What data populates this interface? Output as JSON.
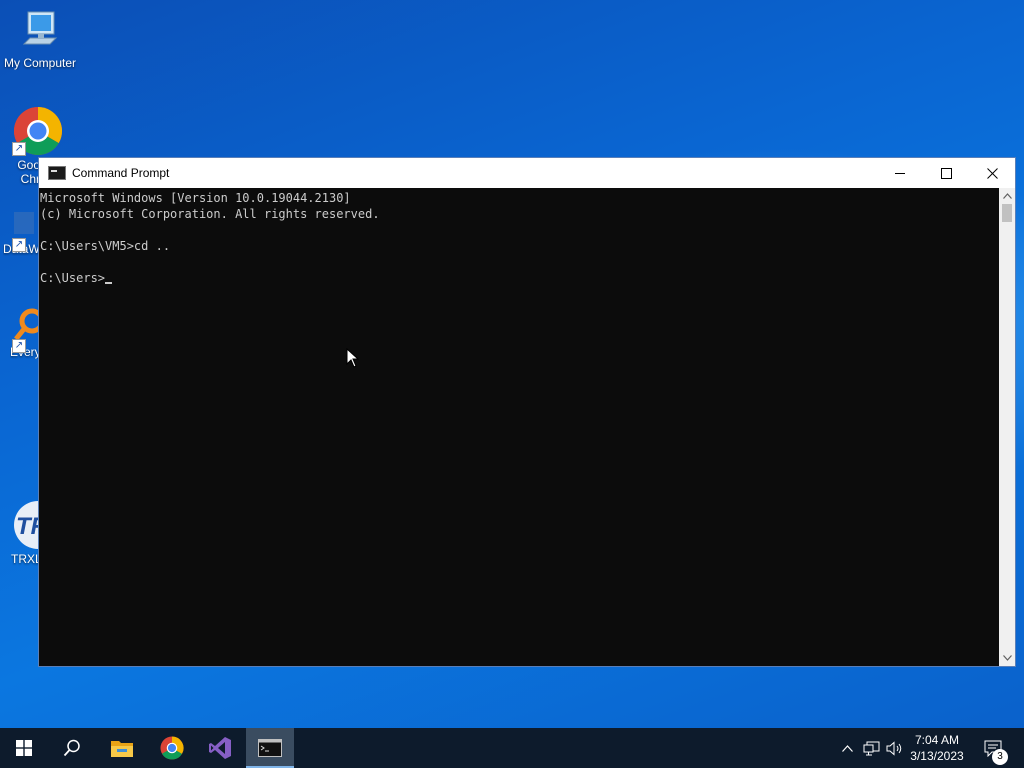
{
  "desktop": {
    "icons": [
      {
        "label": "My Computer",
        "icon": "computer-icon"
      },
      {
        "label": "Goo\nChr",
        "icon": "chrome-icon"
      },
      {
        "label": "DataW",
        "icon": "datawrapper-icon"
      },
      {
        "label": "Every",
        "icon": "everything-search-icon"
      },
      {
        "label": "TRXL",
        "icon": "trxl-icon"
      }
    ]
  },
  "window": {
    "title": "Command Prompt",
    "lines": [
      "Microsoft Windows [Version 10.0.19044.2130]",
      "(c) Microsoft Corporation. All rights reserved.",
      "",
      "C:\\Users\\VM5>cd ..",
      ""
    ],
    "prompt": "C:\\Users>"
  },
  "taskbar": {
    "items": [
      "start-icon",
      "search-icon",
      "file-explorer-icon",
      "chrome-icon",
      "visual-studio-icon",
      "command-prompt-icon"
    ],
    "active_item": "command-prompt-icon",
    "clock_time": "7:04 AM",
    "clock_date": "3/13/2023",
    "notification_count": "3"
  },
  "colors": {
    "console_bg": "#0c0c0c",
    "console_fg": "#cccccc",
    "taskbar_bg": "#0d1b2c"
  }
}
